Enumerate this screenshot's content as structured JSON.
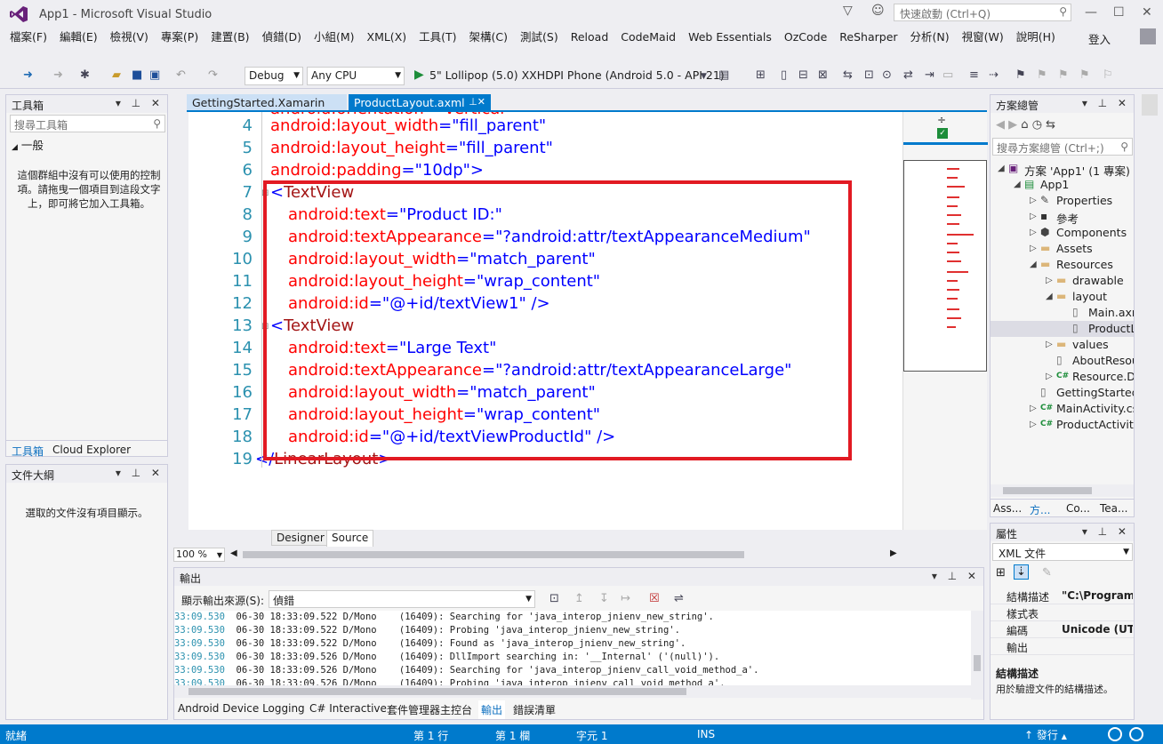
{
  "window": {
    "title": "App1 - Microsoft Visual Studio",
    "quick_launch_placeholder": "快速啟動 (Ctrl+Q)",
    "signin": "登入"
  },
  "menu": [
    "檔案(F)",
    "編輯(E)",
    "檢視(V)",
    "專案(P)",
    "建置(B)",
    "偵錯(D)",
    "小組(M)",
    "XML(X)",
    "工具(T)",
    "架構(C)",
    "測試(S)",
    "Reload",
    "CodeMaid",
    "Web Essentials",
    "OzCode",
    "ReSharper",
    "分析(N)",
    "視窗(W)",
    "說明(H)"
  ],
  "toolbar": {
    "config": "Debug",
    "platform": "Any CPU",
    "run_target": "5\" Lollipop (5.0) XXHDPI Phone (Android 5.0 - API 21)"
  },
  "toolbox": {
    "title": "工具箱",
    "search_placeholder": "搜尋工具箱",
    "group": "一般",
    "empty_message": "這個群組中沒有可以使用的控制項。請拖曳一個項目到這段文字上，即可將它加入工具箱。",
    "tabs": [
      "工具箱",
      "Cloud Explorer"
    ]
  },
  "outline": {
    "title": "文件大綱",
    "empty_message": "選取的文件沒有項目顯示。"
  },
  "tabs": [
    {
      "label": "GettingStarted.Xamarin"
    },
    {
      "label": "ProductLayout.axml"
    }
  ],
  "code_lines": [
    {
      "n": "4",
      "indent": 0,
      "parts": [
        {
          "t": "android:layout_width",
          "c": "attr"
        },
        {
          "t": "=\"",
          "c": "pun"
        },
        {
          "t": "fill_parent",
          "c": "val"
        },
        {
          "t": "\"",
          "c": "pun"
        }
      ]
    },
    {
      "n": "5",
      "indent": 0,
      "parts": [
        {
          "t": "android:layout_height",
          "c": "attr"
        },
        {
          "t": "=\"",
          "c": "pun"
        },
        {
          "t": "fill_parent",
          "c": "val"
        },
        {
          "t": "\"",
          "c": "pun"
        }
      ]
    },
    {
      "n": "6",
      "indent": 0,
      "parts": [
        {
          "t": "android:padding",
          "c": "attr"
        },
        {
          "t": "=\"",
          "c": "pun"
        },
        {
          "t": "10dp",
          "c": "val"
        },
        {
          "t": "\">",
          "c": "pun"
        }
      ]
    },
    {
      "n": "7",
      "indent": 0,
      "parts": [
        {
          "t": "<",
          "c": "pun"
        },
        {
          "t": "TextView",
          "c": "tag"
        }
      ]
    },
    {
      "n": "8",
      "indent": 1,
      "parts": [
        {
          "t": "android:text",
          "c": "attr"
        },
        {
          "t": "=\"",
          "c": "pun"
        },
        {
          "t": "Product ID:",
          "c": "val"
        },
        {
          "t": "\"",
          "c": "pun"
        }
      ]
    },
    {
      "n": "9",
      "indent": 1,
      "parts": [
        {
          "t": "android:textAppearance",
          "c": "attr"
        },
        {
          "t": "=\"",
          "c": "pun"
        },
        {
          "t": "?android:attr/textAppearanceMedium",
          "c": "val"
        },
        {
          "t": "\"",
          "c": "pun"
        }
      ]
    },
    {
      "n": "10",
      "indent": 1,
      "parts": [
        {
          "t": "android:layout_width",
          "c": "attr"
        },
        {
          "t": "=\"",
          "c": "pun"
        },
        {
          "t": "match_parent",
          "c": "val"
        },
        {
          "t": "\"",
          "c": "pun"
        }
      ]
    },
    {
      "n": "11",
      "indent": 1,
      "parts": [
        {
          "t": "android:layout_height",
          "c": "attr"
        },
        {
          "t": "=\"",
          "c": "pun"
        },
        {
          "t": "wrap_content",
          "c": "val"
        },
        {
          "t": "\"",
          "c": "pun"
        }
      ]
    },
    {
      "n": "12",
      "indent": 1,
      "parts": [
        {
          "t": "android:id",
          "c": "attr"
        },
        {
          "t": "=\"",
          "c": "pun"
        },
        {
          "t": "@+id/textView1",
          "c": "val"
        },
        {
          "t": "\" />",
          "c": "pun"
        }
      ]
    },
    {
      "n": "13",
      "indent": 0,
      "parts": [
        {
          "t": "<",
          "c": "pun"
        },
        {
          "t": "TextView",
          "c": "tag"
        }
      ]
    },
    {
      "n": "14",
      "indent": 1,
      "parts": [
        {
          "t": "android:text",
          "c": "attr"
        },
        {
          "t": "=\"",
          "c": "pun"
        },
        {
          "t": "Large Text",
          "c": "val"
        },
        {
          "t": "\"",
          "c": "pun"
        }
      ]
    },
    {
      "n": "15",
      "indent": 1,
      "parts": [
        {
          "t": "android:textAppearance",
          "c": "attr"
        },
        {
          "t": "=\"",
          "c": "pun"
        },
        {
          "t": "?android:attr/textAppearanceLarge",
          "c": "val"
        },
        {
          "t": "\"",
          "c": "pun"
        }
      ]
    },
    {
      "n": "16",
      "indent": 1,
      "parts": [
        {
          "t": "android:layout_width",
          "c": "attr"
        },
        {
          "t": "=\"",
          "c": "pun"
        },
        {
          "t": "match_parent",
          "c": "val"
        },
        {
          "t": "\"",
          "c": "pun"
        }
      ]
    },
    {
      "n": "17",
      "indent": 1,
      "parts": [
        {
          "t": "android:layout_height",
          "c": "attr"
        },
        {
          "t": "=\"",
          "c": "pun"
        },
        {
          "t": "wrap_content",
          "c": "val"
        },
        {
          "t": "\"",
          "c": "pun"
        }
      ]
    },
    {
      "n": "18",
      "indent": 1,
      "parts": [
        {
          "t": "android:id",
          "c": "attr"
        },
        {
          "t": "=\"",
          "c": "pun"
        },
        {
          "t": "@+id/textViewProductId",
          "c": "val"
        },
        {
          "t": "\" />",
          "c": "pun"
        }
      ]
    },
    {
      "n": "19",
      "indent": -1,
      "parts": [
        {
          "t": "</",
          "c": "pun"
        },
        {
          "t": "LinearLayout",
          "c": "tag"
        },
        {
          "t": ">",
          "c": "pun"
        }
      ]
    }
  ],
  "editor": {
    "view_tabs": [
      "Designer",
      "Source"
    ],
    "zoom": "100 %"
  },
  "output": {
    "title": "輸出",
    "source_label": "顯示輸出來源(S):",
    "source_value": "偵錯",
    "lines": [
      {
        "ts": "33:09.530",
        "text": "  06-30 18:33:09.522 D/Mono    (16409): Searching for 'java_interop_jnienv_new_string'."
      },
      {
        "ts": "33:09.530",
        "text": "  06-30 18:33:09.522 D/Mono    (16409): Probing 'java_interop_jnienv_new_string'."
      },
      {
        "ts": "33:09.530",
        "text": "  06-30 18:33:09.522 D/Mono    (16409): Found as 'java_interop_jnienv_new_string'."
      },
      {
        "ts": "33:09.530",
        "text": "  06-30 18:33:09.526 D/Mono    (16409): DllImport searching in: '__Internal' ('(null)')."
      },
      {
        "ts": "33:09.530",
        "text": "  06-30 18:33:09.526 D/Mono    (16409): Searching for 'java_interop_jnienv_call_void_method_a'."
      },
      {
        "ts": "33:09.530",
        "text": "  06-30 18:33:09.526 D/Mono    (16409): Probing 'java interop jnienv call void method a'."
      }
    ],
    "bottom_tabs": [
      "Android Device Logging",
      "C# Interactive",
      "套件管理器主控台",
      "輸出",
      "錯誤清單"
    ]
  },
  "solution": {
    "title": "方案總管",
    "search_placeholder": "搜尋方案總管 (Ctrl+;)",
    "items": [
      {
        "label": "方案 'App1' (1 專案)",
        "level": 0,
        "icon": "solution-icon"
      },
      {
        "label": "App1",
        "level": 1,
        "icon": "project-icon"
      },
      {
        "label": "Properties",
        "level": 2,
        "icon": "wrench-icon"
      },
      {
        "label": "參考",
        "level": 2,
        "icon": "references-icon"
      },
      {
        "label": "Components",
        "level": 2,
        "icon": "component-icon"
      },
      {
        "label": "Assets",
        "level": 2,
        "icon": "folder-icon"
      },
      {
        "label": "Resources",
        "level": 2,
        "icon": "folder-icon"
      },
      {
        "label": "drawable",
        "level": 3,
        "icon": "folder-icon"
      },
      {
        "label": "layout",
        "level": 3,
        "icon": "folder-icon"
      },
      {
        "label": "Main.axml",
        "level": 4,
        "icon": "file-icon"
      },
      {
        "label": "ProductLay",
        "level": 4,
        "icon": "file-icon"
      },
      {
        "label": "values",
        "level": 3,
        "icon": "folder-icon"
      },
      {
        "label": "AboutResour",
        "level": 3,
        "icon": "file-icon"
      },
      {
        "label": "Resource.Des",
        "level": 3,
        "icon": "csharp-icon"
      },
      {
        "label": "GettingStarted.X",
        "level": 2,
        "icon": "file-icon"
      },
      {
        "label": "MainActivity.cs",
        "level": 2,
        "icon": "csharp-icon"
      },
      {
        "label": "ProductActivity.c",
        "level": 2,
        "icon": "csharp-icon"
      }
    ],
    "bottom_tabs": [
      "Ass...",
      "方...",
      "Co...",
      "Tea..."
    ]
  },
  "properties": {
    "title": "屬性",
    "object": "XML 文件",
    "rows": [
      {
        "name": "結構描述",
        "value": "\"C:\\Program F"
      },
      {
        "name": "樣式表",
        "value": ""
      },
      {
        "name": "編碼",
        "value": "Unicode (UTF-"
      },
      {
        "name": "輸出",
        "value": ""
      }
    ],
    "desc_title": "結構描述",
    "desc_text": "用於驗證文件的結構描述。"
  },
  "status": {
    "ready": "就緒",
    "line": "第 1 行",
    "col": "第 1 欄",
    "char": "字元 1",
    "ins": "INS",
    "publish": "發行"
  }
}
